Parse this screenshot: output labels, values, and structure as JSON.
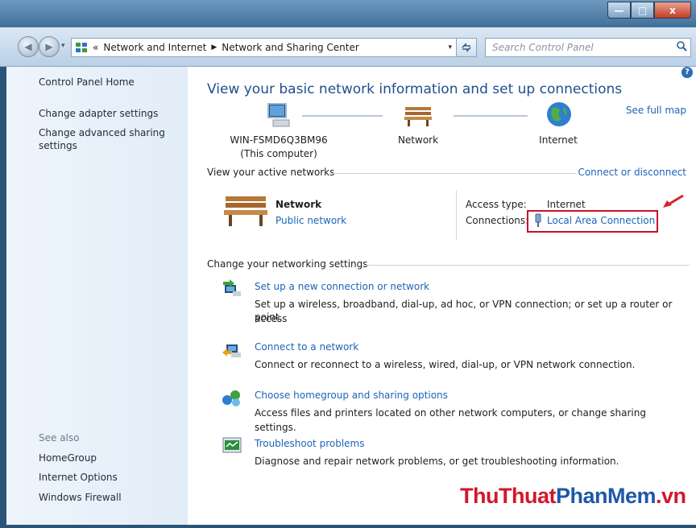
{
  "window": {
    "min_label": "—",
    "max_label": "□",
    "close_label": "x"
  },
  "address": {
    "prefix": "«",
    "crumb1": "Network and Internet",
    "crumb2": "Network and Sharing Center",
    "sep": "▶",
    "dropdown": "▾"
  },
  "search": {
    "placeholder": "Search Control Panel"
  },
  "left_pane": {
    "home": "Control Panel Home",
    "adapter": "Change adapter settings",
    "advanced_line1": "Change advanced sharing",
    "advanced_line2": "settings",
    "see_also": "See also",
    "homegroup": "HomeGroup",
    "internet_options": "Internet Options",
    "firewall": "Windows Firewall"
  },
  "main": {
    "help": "?",
    "title": "View your basic network information and set up connections",
    "see_full_map": "See full map",
    "computer_name": "WIN-FSMD6Q3BM96",
    "computer_sub": "(This computer)",
    "network_label": "Network",
    "internet_label": "Internet",
    "active_header": "View your active networks",
    "connect_disconnect": "Connect or disconnect",
    "active_network_name": "Network",
    "active_network_type": "Public network",
    "access_type_label": "Access type:",
    "access_type_value": "Internet",
    "connections_label": "Connections:",
    "connections_value": "Local Area Connection",
    "change_header": "Change your networking settings",
    "tasks": [
      {
        "title": "Set up a new connection or network",
        "desc_line1": "Set up a wireless, broadband, dial-up, ad hoc, or VPN connection; or set up a router or access",
        "desc_line2": "point."
      },
      {
        "title": "Connect to a network",
        "desc_line1": "Connect or reconnect to a wireless, wired, dial-up, or VPN network connection."
      },
      {
        "title": "Choose homegroup and sharing options",
        "desc_line1": "Access files and printers located on other network computers, or change sharing settings."
      },
      {
        "title": "Troubleshoot problems",
        "desc_line1": "Diagnose and repair network problems, or get troubleshooting information."
      }
    ]
  },
  "watermark": {
    "part1": "ThuThuat",
    "part2": "PhanMem",
    "part3": ".vn"
  },
  "colors": {
    "link": "#1c64b8",
    "title": "#1f4f8f",
    "highlight_box": "#c8102e",
    "watermark_red": "#d3172a",
    "watermark_blue": "#1f57a8"
  }
}
